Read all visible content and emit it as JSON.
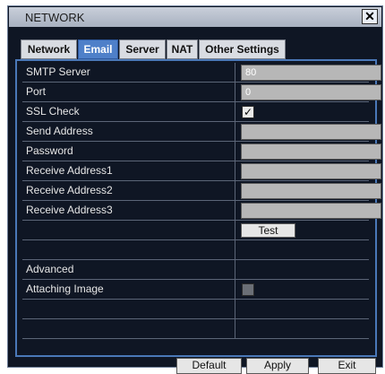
{
  "window": {
    "title": "NETWORK"
  },
  "tabs": [
    "Network",
    "Email",
    "Server",
    "NAT",
    "Other Settings"
  ],
  "active_tab": "Email",
  "email": {
    "smtp_server_label": "SMTP Server",
    "smtp_server_value": "80",
    "port_label": "Port",
    "port_value": "0",
    "ssl_label": "SSL Check",
    "ssl_checked": true,
    "send_label": "Send Address",
    "password_label": "Password",
    "recv1_label": "Receive Address1",
    "recv2_label": "Receive Address2",
    "recv3_label": "Receive Address3",
    "test_label": "Test",
    "advanced_label": "Advanced",
    "attach_label": "Attaching Image",
    "attach_checked": false
  },
  "footer": {
    "default_label": "Default",
    "apply_label": "Apply",
    "exit_label": "Exit"
  },
  "colors": {
    "accent": "#4f80c9",
    "panel_bg": "#0f1624",
    "field_bg": "#b7b7b7"
  }
}
